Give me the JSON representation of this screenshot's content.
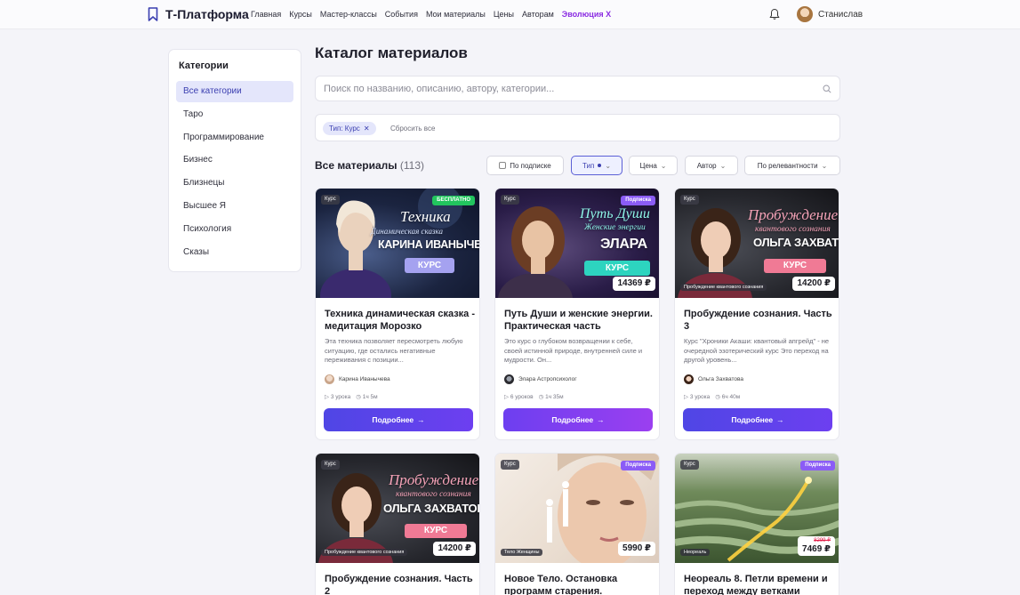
{
  "header": {
    "logo": "Т-Платформа",
    "nav": [
      "Главная",
      "Курсы",
      "Мастер-классы",
      "События",
      "Мои материалы",
      "Цены",
      "Авторам"
    ],
    "nav_special": "Эволюция X",
    "user_name": "Станислав"
  },
  "sidebar": {
    "title": "Категории",
    "items": [
      "Все категории",
      "Таро",
      "Программирование",
      "Бизнес",
      "Близнецы",
      "Высшее Я",
      "Психология",
      "Сказы"
    ]
  },
  "main": {
    "title": "Каталог материалов",
    "search_placeholder": "Поиск по названию, описанию, автору, категории...",
    "active_filter": "Тип: Курс",
    "reset": "Сбросить все",
    "section_title": "Все материалы",
    "count": "(113)",
    "filters": {
      "subscription": "По подписке",
      "type": "Тип",
      "price": "Цена",
      "author": "Автор",
      "sort": "По релевантности"
    },
    "more_label": "Подробнее",
    "type_badge": "Курс"
  },
  "cards": [
    {
      "image_headline": "Техника",
      "image_subheadline": "Динамическая сказка",
      "image_name": "КАРИНА ИВАНЫЧЕВА",
      "image_button": "КУРС",
      "badge": "БЕСПЛАТНО",
      "title": "Техника динамическая сказка - медитация Морозко",
      "desc": "Эта техника позволяет пересмотреть любую ситуацию, где остались негативные переживания с позиции...",
      "author": "Карина Иванычева",
      "lessons": "3 урока",
      "duration": "1ч 5м"
    },
    {
      "image_headline": "Путь Души",
      "image_subheadline": "Женские энергии",
      "image_name": "ЭЛАРА",
      "image_button": "КУРС",
      "badge": "Подписка",
      "price": "14369 ₽",
      "title": "Путь Души и женские энергии. Практическая часть",
      "desc": "Это курс о глубоком возвращении к себе, своей истинной природе, внутренней силе и мудрости. Он...",
      "author": "Элара Астропсихолог",
      "lessons": "6 уроков",
      "duration": "1ч 35м"
    },
    {
      "image_headline": "Пробуждение",
      "image_subheadline": "квантового сознания",
      "image_name": "ОЛЬГА ЗАХВАТОВА",
      "image_button": "КУРС",
      "caption": "Пробуждение квантового сознания",
      "price": "14200 ₽",
      "title": "Пробуждение сознания. Часть 3",
      "desc": "Курс \"Хроники Акаши: квантовый апгрейд\" - не очередной эзотерический курс Это переход на другой уровень...",
      "author": "Ольга Захватова",
      "lessons": "3 урока",
      "duration": "6ч 40м"
    },
    {
      "image_headline": "Пробуждение",
      "image_subheadline": "квантового сознания",
      "image_name": "ОЛЬГА ЗАХВАТОВА",
      "image_button": "КУРС",
      "caption": "Пробуждение квантового сознания",
      "price": "14200 ₽",
      "title": "Пробуждение сознания. Часть 2"
    },
    {
      "badge": "Подписка",
      "caption": "Тело Женщины",
      "price": "5990 ₽",
      "title": "Новое Тело. Остановка программ старения."
    },
    {
      "badge": "Подписка",
      "caption": "Неореаль",
      "price_old": "8299 ₽",
      "price": "7469 ₽",
      "title": "Неореаль 8. Петли времени и переход между ветками"
    }
  ]
}
